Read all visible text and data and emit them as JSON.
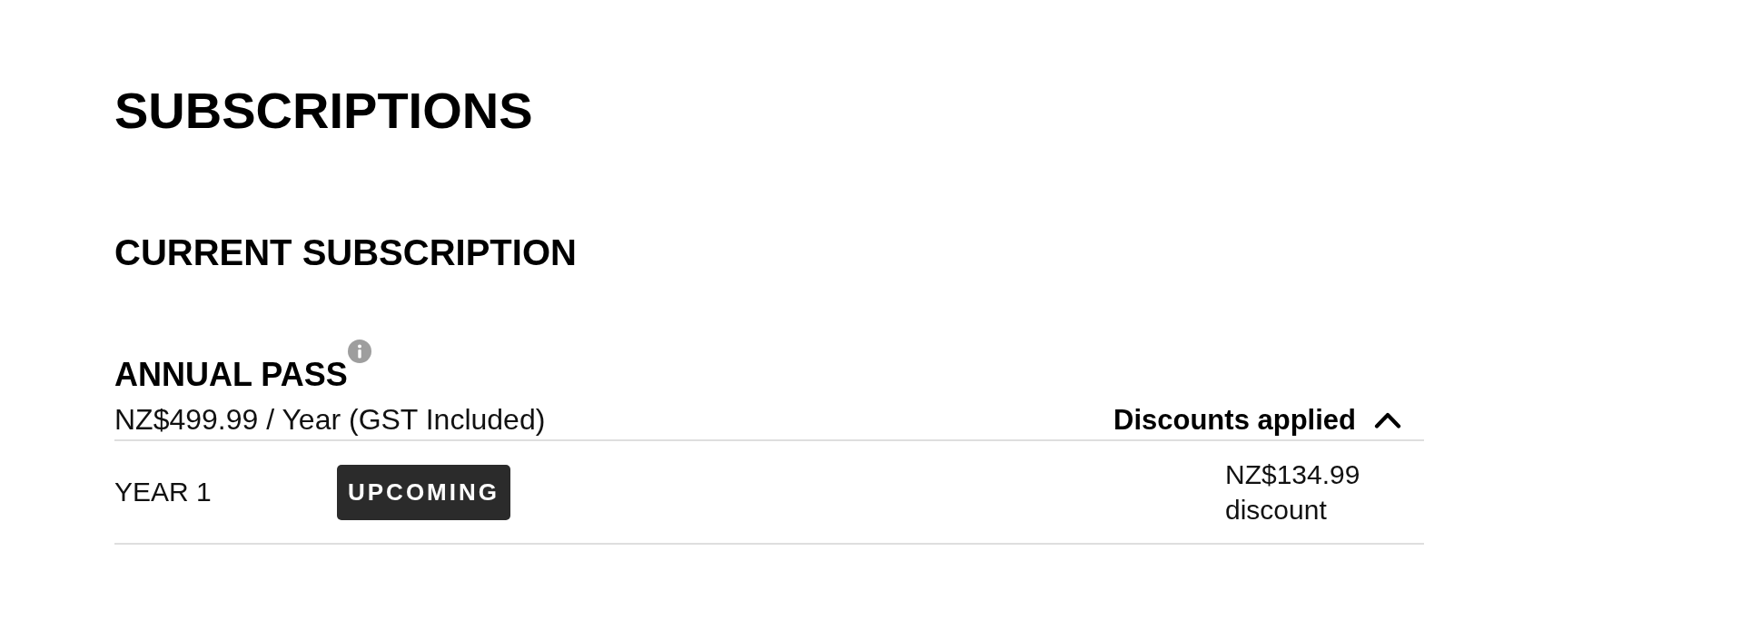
{
  "page": {
    "title": "SUBSCRIPTIONS"
  },
  "current_subscription": {
    "heading": "CURRENT SUBSCRIPTION",
    "plan": {
      "name": "ANNUAL PASS",
      "price": "NZ$499.99 / Year (GST Included)"
    },
    "discounts_toggle": {
      "label": "Discounts applied",
      "expanded": true
    },
    "periods": [
      {
        "label": "YEAR 1",
        "status": "UPCOMING",
        "discount": "NZ$134.99 discount"
      }
    ]
  }
}
